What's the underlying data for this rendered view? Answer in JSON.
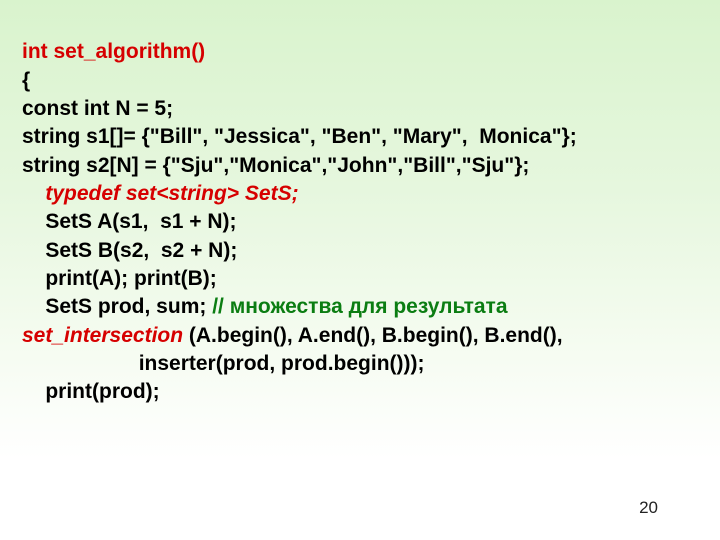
{
  "slide": {
    "page_number": "20"
  },
  "code": {
    "func_sig": "int set_algorithm()",
    "brace_open": "{",
    "const_n": "const int N = 5;",
    "s1_decl": "string s1[]= {\"Bill\", \"Jessica\", \"Ben\", \"Mary\",  Monica\"};",
    "s2_decl": "string s2[N] = {\"Sju\",\"Monica\",\"John\",\"Bill\",\"Sju\"};",
    "typedef_line": "    typedef set<string> SetS;",
    "sets_a": "    SetS A(s1,  s1 + N);",
    "sets_b": "    SetS B(s2,  s2 + N);",
    "print_ab": "    print(A); print(B);",
    "prod_sum_prefix": "    SetS prod, sum; ",
    "prod_sum_comment": "// множества для результата",
    "set_inter_kw": "set_intersection",
    "set_inter_rest": " (A.begin(), A.end(), B.begin(), B.end(),",
    "inserter_line": "                    inserter(prod, prod.begin()));",
    "print_prod": "    print(prod);"
  }
}
